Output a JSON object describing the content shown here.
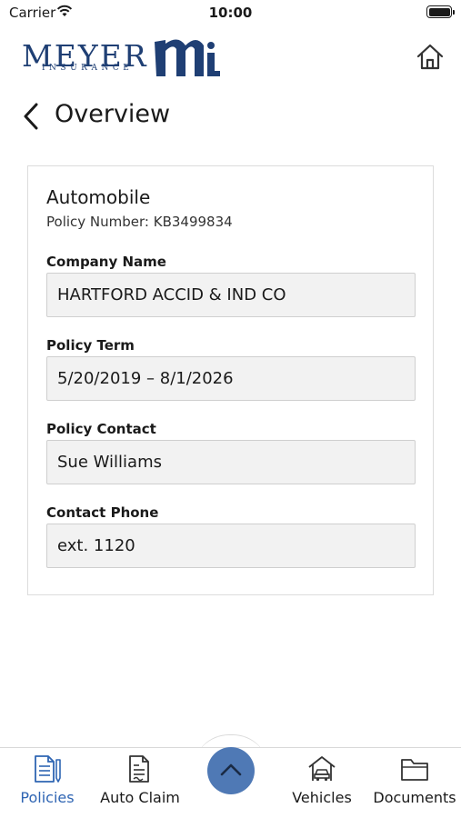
{
  "status_bar": {
    "carrier": "Carrier",
    "time": "10:00"
  },
  "header": {
    "logo_text": "MEYER",
    "logo_subtext": "INSURANCE",
    "home_icon": "home-icon"
  },
  "page": {
    "title": "Overview",
    "back_icon": "chevron-left-icon"
  },
  "policy": {
    "type": "Automobile",
    "number_line": "Policy Number: KB3499834",
    "fields": [
      {
        "label": "Company Name",
        "value": "HARTFORD ACCID & IND CO"
      },
      {
        "label": "Policy Term",
        "value": "5/20/2019 – 8/1/2026"
      },
      {
        "label": "Policy Contact",
        "value": "Sue Williams"
      },
      {
        "label": "Contact Phone",
        "value": "ext. 1120"
      }
    ]
  },
  "tab_bar": {
    "tabs": [
      {
        "label": "Policies",
        "icon": "policy-document-icon",
        "active": true
      },
      {
        "label": "Auto Claim",
        "icon": "claim-form-icon",
        "active": false
      },
      {
        "label": "Vehicles",
        "icon": "car-garage-icon",
        "active": false
      },
      {
        "label": "Documents",
        "icon": "folder-icon",
        "active": false
      }
    ],
    "center_button_icon": "chevron-up-icon"
  },
  "colors": {
    "brand_navy": "#1f3f74",
    "active_tab": "#2f65b3",
    "center_button": "#4f79b5",
    "field_background": "#f2f2f2"
  }
}
